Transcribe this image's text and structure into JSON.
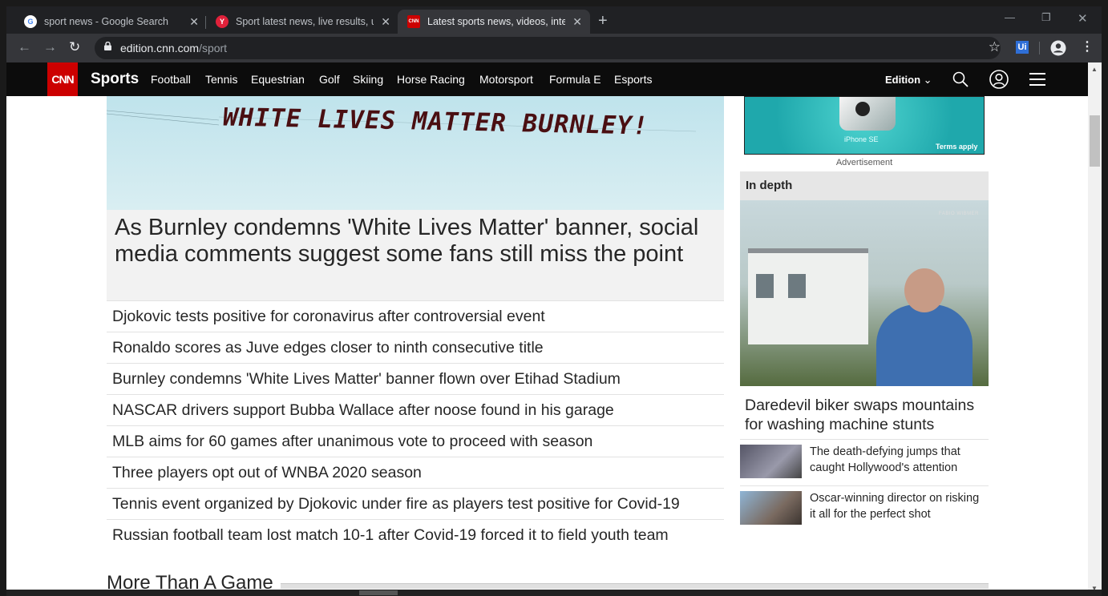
{
  "browser": {
    "tabs": [
      {
        "title": "sport news - Google Search",
        "icon": "google-g-icon",
        "active": false
      },
      {
        "title": "Sport latest news, live results, upc",
        "icon": "yahoo-sport-icon",
        "active": false
      },
      {
        "title": "Latest sports news, videos, interv",
        "icon": "cnn-icon",
        "active": true
      }
    ],
    "url_host": "edition.cnn.com",
    "url_path": "/sport",
    "extension_label": "Ui"
  },
  "nav": {
    "logo": "CNN",
    "section": "Sports",
    "links": [
      "Football",
      "Tennis",
      "Equestrian",
      "Golf",
      "Skiing",
      "Horse Racing",
      "Motorsport",
      "Formula E",
      "Esports"
    ],
    "edition": "Edition"
  },
  "hero": {
    "banner_text": "WHITE LIVES MATTER BURNLEY!",
    "headline": "As Burnley condemns 'White Lives Matter' banner, social media comments suggest some fans still miss the point"
  },
  "stories": [
    "Djokovic tests positive for coronavirus after controversial event",
    "Ronaldo scores as Juve edges closer to ninth consecutive title",
    "Burnley condemns 'White Lives Matter' banner flown over Etihad Stadium",
    "NASCAR drivers support Bubba Wallace after noose found in his garage",
    "MLB aims for 60 games after unanimous vote to proceed with season",
    "Three players opt out of WNBA 2020 season",
    "Tennis event organized by Djokovic under fire as players test positive for Covid-19",
    "Russian football team lost match 10-1 after Covid-19 forced it to field youth team"
  ],
  "more_section": "More Than A Game",
  "ad": {
    "product": "iPhone SE",
    "terms": "Terms apply",
    "label": "Advertisement"
  },
  "in_depth": {
    "heading": "In depth",
    "credit": "FABIO WIBMER",
    "featured": "Daredevil biker swaps mountains for washing machine stunts",
    "items": [
      "The death-defying jumps that caught Hollywood's attention",
      "Oscar-winning director on risking it all for the perfect shot"
    ]
  },
  "colors": {
    "cnn_red": "#cc0000",
    "nav_bg": "#0c0c0c",
    "chrome_dark": "#202124"
  }
}
